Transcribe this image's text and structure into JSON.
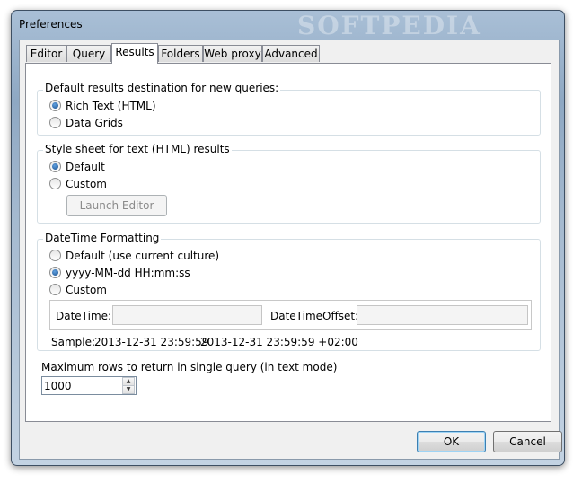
{
  "window": {
    "title": "Preferences",
    "watermark": "SOFTPEDIA"
  },
  "tabs": [
    {
      "label": "Editor"
    },
    {
      "label": "Query"
    },
    {
      "label": "Results"
    },
    {
      "label": "Folders"
    },
    {
      "label": "Web proxy"
    },
    {
      "label": "Advanced"
    }
  ],
  "active_tab": "Results",
  "destination": {
    "heading": "Default results destination for new queries:",
    "options": [
      "Rich Text (HTML)",
      "Data Grids"
    ],
    "selected": "Rich Text (HTML)"
  },
  "stylesheet": {
    "heading": "Style sheet for text (HTML) results",
    "options": [
      "Default",
      "Custom"
    ],
    "selected": "Default",
    "launch_label": "Launch Editor"
  },
  "datetime": {
    "heading": "DateTime Formatting",
    "options": [
      "Default (use current culture)",
      "yyyy-MM-dd HH:mm:ss",
      "Custom"
    ],
    "selected": "yyyy-MM-dd HH:mm:ss",
    "datetime_label": "DateTime:",
    "datetime_value": "",
    "offset_label": "DateTimeOffset:",
    "offset_value": "",
    "sample_label": "Sample:",
    "sample_datetime": "2013-12-31 23:59:59",
    "sample_offset": "2013-12-31 23:59:59 +02:00"
  },
  "maxrows": {
    "label": "Maximum rows to return in single query (in text mode)",
    "value": "1000"
  },
  "footer": {
    "ok": "OK",
    "cancel": "Cancel"
  }
}
